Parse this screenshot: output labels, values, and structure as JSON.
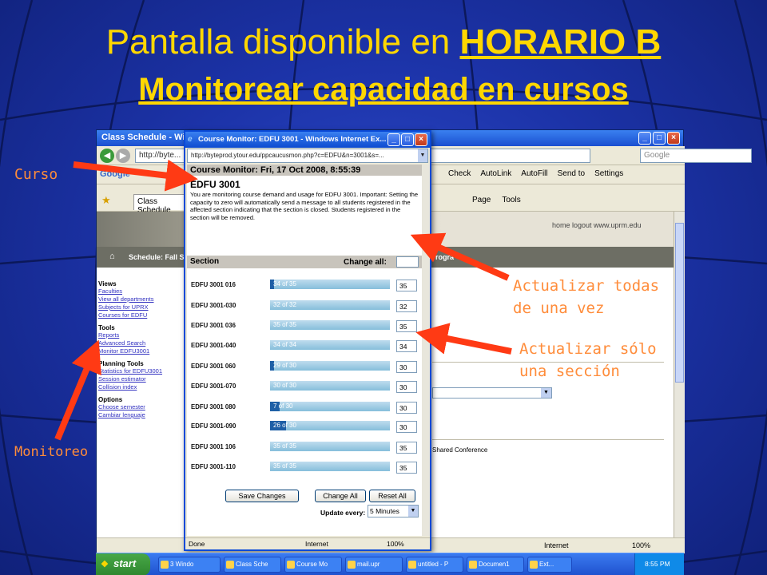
{
  "slide": {
    "title_prefix": "Pantalla disponible en ",
    "title_link": "HORARIO B",
    "title_line2": "Monitorear capacidad en cursos"
  },
  "annotations": {
    "curso": "Curso",
    "monitoreo": "Monitoreo",
    "todas_line1": "Actualizar todas",
    "todas_line2": "de una vez",
    "sola_line1": "Actualizar sólo",
    "sola_line2": "una sección",
    "arrow_color": "#ff3a14"
  },
  "background_browser": {
    "title": "Class Schedule - Wind",
    "address": "http://byte...",
    "search_placeholder": "Google",
    "google_label": "Google",
    "toolbar_items": [
      "Check",
      "AutoLink",
      "AutoFill",
      "Send to",
      "Settings"
    ],
    "tab_label": "Class Schedule",
    "command_items": [
      "Page",
      "Tools"
    ],
    "banner_links": "home  logout  www.uprm.edu",
    "nav_label": "Schedule: Fall Sem",
    "nav_label2": "Progra",
    "sidebar": [
      {
        "heading": "Views",
        "links": [
          "Faculties",
          "View all departments",
          "Subjects for UPRX",
          "Courses for EDFU"
        ]
      },
      {
        "heading": "Tools",
        "links": [
          "Reports",
          "Advanced Search",
          "Monitor EDFU3001"
        ]
      },
      {
        "heading": "Planning Tools",
        "links": [
          "Statistics for EDFU3001",
          "Session estimator",
          "Collision index"
        ]
      },
      {
        "heading": "Options",
        "links": [
          "Choose semester",
          "Cambiar lenguaje"
        ]
      }
    ],
    "panel_text": "Shared Conference",
    "status_internet": "Internet",
    "status_zoom": "100%"
  },
  "popup": {
    "title": "Course Monitor: EDFU 3001 - Windows Internet Ex...",
    "address": "http://byteprod.ytour.edu/ppcaucusmon.php?c=EDFU&n=3001&s=...",
    "header": "Course Monitor: Fri, 17 Oct 2008, 8:55:39",
    "course": "EDFU 3001",
    "description": "You are monitoring course demand and usage for EDFU 3001. Important: Setting the capacity to zero will automatically send a message to all students registered in the affected section indicating that the section is closed. Students registered in the section will be removed.",
    "section_label": "Section",
    "change_all_label": "Change all:",
    "sections": [
      {
        "name": "EDFU 3001 016",
        "usage": "34 of 35",
        "fill": 0.03,
        "capacity": "35"
      },
      {
        "name": "EDFU 3001-030",
        "usage": "32 of 32",
        "fill": 0.0,
        "capacity": "32"
      },
      {
        "name": "EDFU 3001 036",
        "usage": "35 of 35",
        "fill": 0.0,
        "capacity": "35"
      },
      {
        "name": "EDFU 3001-040",
        "usage": "34 of 34",
        "fill": 0.0,
        "capacity": "34"
      },
      {
        "name": "EDFU 3001 060",
        "usage": "29 of 30",
        "fill": 0.03,
        "capacity": "30"
      },
      {
        "name": "EDFU 3001-070",
        "usage": "30 of 30",
        "fill": 0.0,
        "capacity": "30"
      },
      {
        "name": "EDFU 3001 080",
        "usage": "7 of 30",
        "fill": 0.08,
        "capacity": "30"
      },
      {
        "name": "EDFU 3001-090",
        "usage": "26 of 30",
        "fill": 0.13,
        "capacity": "30"
      },
      {
        "name": "EDFU 3001 106",
        "usage": "35 of 35",
        "fill": 0.0,
        "capacity": "35"
      },
      {
        "name": "EDFU 3001-110",
        "usage": "35 of 35",
        "fill": 0.0,
        "capacity": "35"
      }
    ],
    "save_label": "Save Changes",
    "change_all_button": "Change All",
    "reset_all_button": "Reset All",
    "update_label": "Update every:",
    "update_value": "5 Minutes",
    "status_done": "Done",
    "status_internet": "Internet",
    "status_zoom": "100%"
  },
  "taskbar": {
    "start_label": "start",
    "items": [
      "3 Windo",
      "Class Sche",
      "Course Mo",
      "mail.upr",
      "untitled - P",
      "Documen1",
      "Ext..."
    ],
    "clock": "8:55 PM"
  }
}
